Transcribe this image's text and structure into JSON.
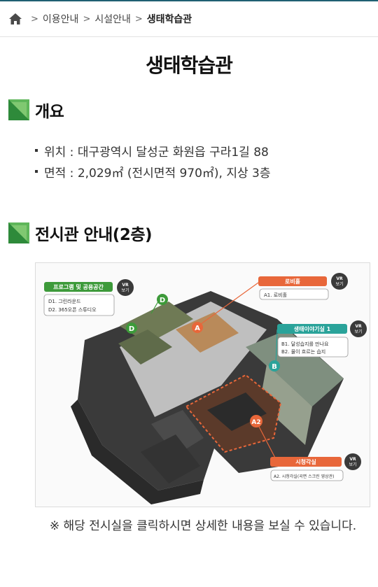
{
  "breadcrumb": {
    "home_icon": "home-icon",
    "items": [
      "이용안내",
      "시설안내"
    ],
    "current": "생태학습관"
  },
  "page_title": "생태학습관",
  "overview": {
    "title": "개요",
    "rows": [
      "위치 : 대구광역시 달성군 화원읍 구라1길 88",
      "면적 : 2,029㎡ (전시면적 970㎡), 지상 3층"
    ]
  },
  "exhibit": {
    "title": "전시관 안내(2층)"
  },
  "map": {
    "program": {
      "title": "프로그램 및 공용공간",
      "lines": [
        "D1. 그린라운드",
        "D2. 365오픈 스튜디오"
      ],
      "color": "#3d9a3a"
    },
    "lobby": {
      "title": "로비홀",
      "lines": [
        "A1. 로비홀"
      ],
      "color": "#e8673a"
    },
    "ecostory": {
      "title": "생태이야기실 1",
      "lines": [
        "B1. 달성습지를 만나요",
        "B2. 물이 흐르는 습지"
      ],
      "color": "#2aa39a"
    },
    "theater": {
      "title": "시청각실",
      "lines": [
        "A2. 시청각실(곡면 스크린 영상관)"
      ],
      "color": "#e8673a"
    },
    "vr_label": [
      "VR",
      "보기"
    ],
    "markers": [
      "D",
      "D",
      "A",
      "B",
      "A2"
    ]
  },
  "notice": "※ 해당 전시실을 클릭하시면 상세한 내용을 보실 수 있습니다."
}
